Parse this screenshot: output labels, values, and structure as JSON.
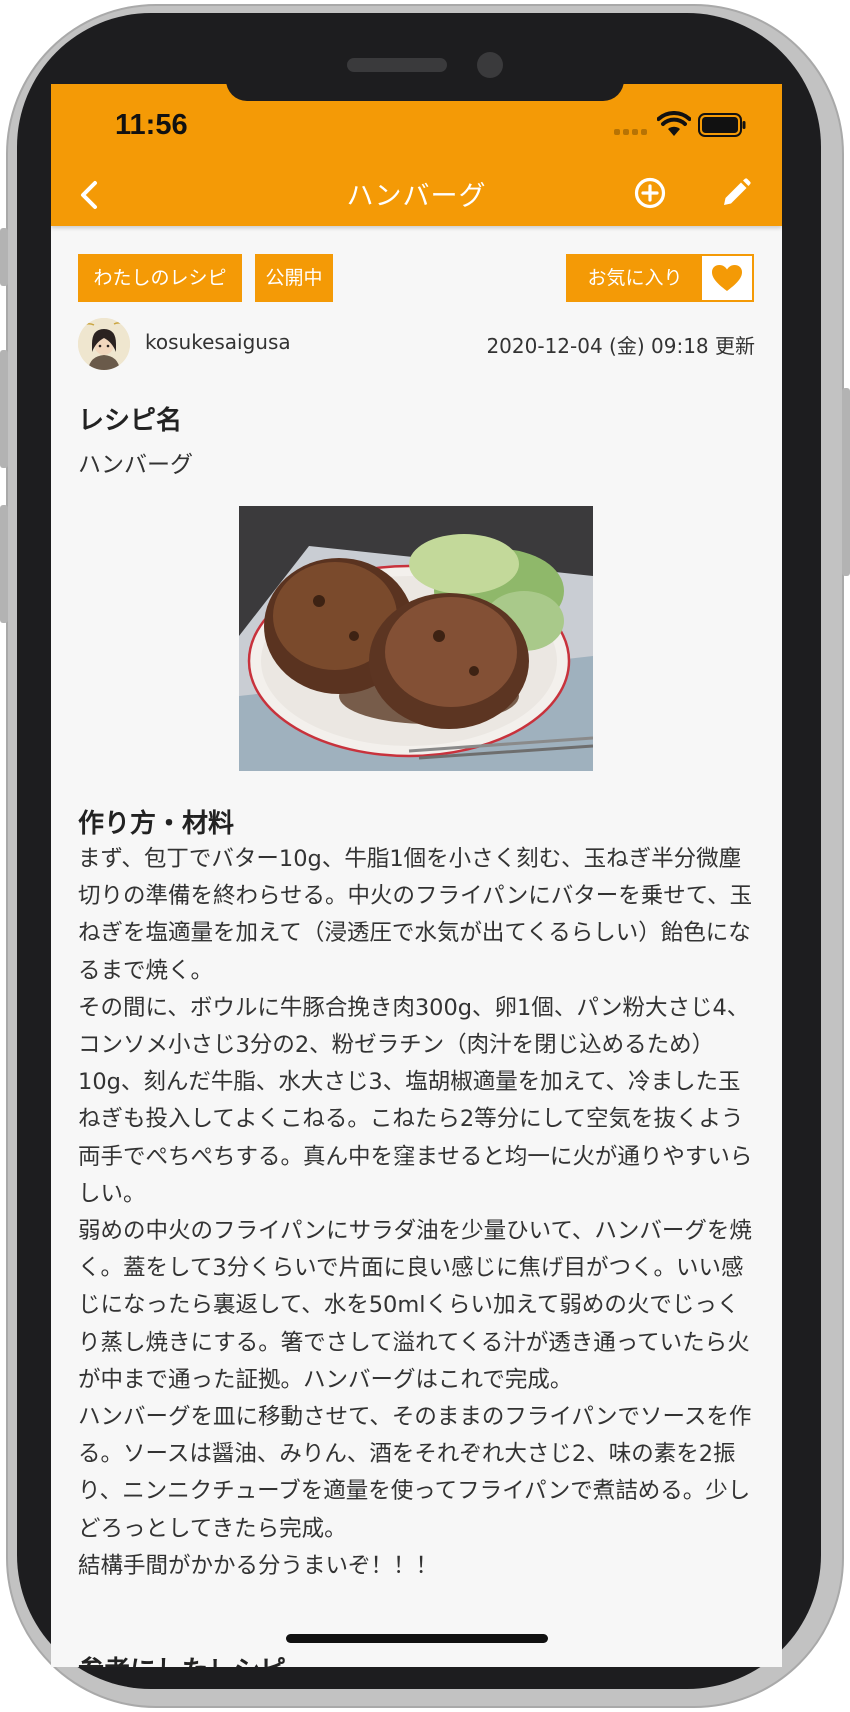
{
  "status_bar": {
    "time": "11:56"
  },
  "nav": {
    "title": "ハンバーグ",
    "back_icon": "chevron-left-icon",
    "add_icon": "plus-circle-icon",
    "edit_icon": "pencil-icon"
  },
  "tags": {
    "my_recipe": "わたしのレシピ",
    "published": "公開中"
  },
  "favorite": {
    "label": "お気に入り",
    "icon": "heart-icon"
  },
  "author": {
    "name": "kosukesaigusa",
    "updated": "2020-12-04 (金) 09:18 更新"
  },
  "recipe": {
    "name_heading": "レシピ名",
    "name": "ハンバーグ",
    "method_heading": "作り方・材料",
    "instructions": "まず、包丁でバター10g、牛脂1個を小さく刻む、玉ねぎ半分微塵切りの準備を終わらせる。中火のフライパンにバターを乗せて、玉ねぎを塩適量を加えて（浸透圧で水気が出てくるらしい）飴色になるまで焼く。\nその間に、ボウルに牛豚合挽き肉300g、卵1個、パン粉大さじ4、コンソメ小さじ3分の2、粉ゼラチン（肉汁を閉じ込めるため）10g、刻んだ牛脂、水大さじ3、塩胡椒適量を加えて、冷ました玉ねぎも投入してよくこねる。こねたら2等分にして空気を抜くよう両手でぺちぺちする。真ん中を窪ませると均一に火が通りやすいらしい。\n弱めの中火のフライパンにサラダ油を少量ひいて、ハンバーグを焼く。蓋をして3分くらいで片面に良い感じに焦げ目がつく。いい感じになったら裏返して、水を50mlくらい加えて弱めの火でじっくり蒸し焼きにする。箸でさして溢れてくる汁が透き通っていたら火が中まで通った証拠。ハンバーグはこれで完成。\nハンバーグを皿に移動させて、そのままのフライパンでソースを作る。ソースは醤油、みりん、酒をそれぞれ大さじ2、味の素を2振り、ニンニクチューブを適量を使ってフライパンで煮詰める。少しどろっとしてきたら完成。\n結構手間がかかる分うまいぞ！！！",
    "reference_heading": "参考にしたレシピ"
  },
  "colors": {
    "accent": "#f49a06",
    "background": "#f7f7f7",
    "text": "#333333"
  }
}
